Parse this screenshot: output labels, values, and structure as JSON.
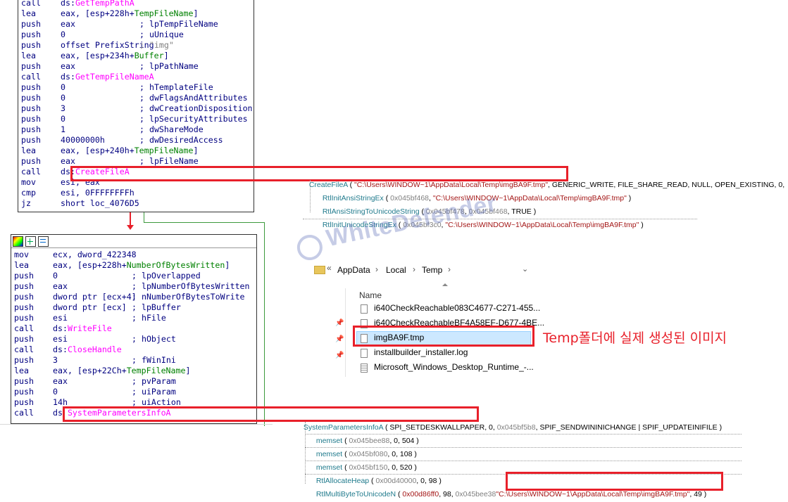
{
  "ida_top": {
    "rows": [
      {
        "mn": "call",
        "op": "ds:",
        "opfn": "GetTempPathA",
        "cm": ""
      },
      {
        "mn": "lea",
        "op": "eax, [esp+228h+",
        "opvar": "TempFileName",
        "op2": "]",
        "cm": ""
      },
      {
        "mn": "push",
        "op": "eax",
        "cm": "; lpTempFileName"
      },
      {
        "mn": "push",
        "op": "0",
        "cm": "; uUnique"
      },
      {
        "mn": "push",
        "op": "offset PrefixString",
        "cm": "; \"img\""
      },
      {
        "mn": "lea",
        "op": "eax, [esp+234h+",
        "opvar": "Buffer",
        "op2": "]",
        "cm": ""
      },
      {
        "mn": "push",
        "op": "eax",
        "cm": "; lpPathName"
      },
      {
        "mn": "call",
        "op": "ds:",
        "opfn": "GetTempFileNameA",
        "cm": ""
      },
      {
        "mn": "push",
        "op": "0",
        "cm": "; hTemplateFile"
      },
      {
        "mn": "push",
        "op": "0",
        "cm": "; dwFlagsAndAttributes"
      },
      {
        "mn": "push",
        "op": "3",
        "cm": "; dwCreationDisposition"
      },
      {
        "mn": "push",
        "op": "0",
        "cm": "; lpSecurityAttributes"
      },
      {
        "mn": "push",
        "op": "1",
        "cm": "; dwShareMode"
      },
      {
        "mn": "push",
        "op": "40000000h",
        "cm": "; dwDesiredAccess"
      },
      {
        "mn": "lea",
        "op": "eax, [esp+240h+",
        "opvar": "TempFileName",
        "op2": "]",
        "cm": ""
      },
      {
        "mn": "push",
        "op": "eax",
        "cm": "; lpFileName"
      },
      {
        "mn": "call",
        "op": "ds:",
        "opfn": "CreateFileA",
        "cm": ""
      },
      {
        "mn": "mov",
        "op": "esi, eax",
        "cm": ""
      },
      {
        "mn": "cmp",
        "op": "esi, 0FFFFFFFFh",
        "cm": ""
      },
      {
        "mn": "jz",
        "op": "short loc_4076D5",
        "cm": ""
      }
    ]
  },
  "ida_bottom": {
    "rows": [
      {
        "mn": "mov",
        "op": "ecx, dword_422348",
        "cm": ""
      },
      {
        "mn": "lea",
        "op": "eax, [esp+228h+",
        "opvar": "NumberOfBytesWritten",
        "op2": "]",
        "cm": ""
      },
      {
        "mn": "push",
        "op": "0",
        "cm": "; lpOverlapped"
      },
      {
        "mn": "push",
        "op": "eax",
        "cm": "; lpNumberOfBytesWritten"
      },
      {
        "mn": "push",
        "op": "dword ptr [ecx+4]",
        "cm": "; nNumberOfBytesToWrite"
      },
      {
        "mn": "push",
        "op": "dword ptr [ecx]",
        "cm": "; lpBuffer"
      },
      {
        "mn": "push",
        "op": "esi",
        "cm": "; hFile"
      },
      {
        "mn": "call",
        "op": "ds:",
        "opfn": "WriteFile",
        "cm": ""
      },
      {
        "mn": "push",
        "op": "esi",
        "cm": "; hObject"
      },
      {
        "mn": "call",
        "op": "ds:",
        "opfn": "CloseHandle",
        "cm": ""
      },
      {
        "mn": "push",
        "op": "3",
        "cm": "; fWinIni"
      },
      {
        "mn": "lea",
        "op": "eax, [esp+22Ch+",
        "opvar": "TempFileName",
        "op2": "]",
        "cm": ""
      },
      {
        "mn": "push",
        "op": "eax",
        "cm": "; pvParam"
      },
      {
        "mn": "push",
        "op": "0",
        "cm": "; uiParam"
      },
      {
        "mn": "push",
        "op": "14h",
        "cm": "; uiAction"
      },
      {
        "mn": "call",
        "op": "ds ",
        "opfn": "SystemParametersInfoA",
        "cm": ""
      }
    ]
  },
  "api_top": {
    "create": {
      "fn": "CreateFileA",
      "p1": " ( ",
      "s1": "\"C:\\Users\\WINDOW~1\\AppData\\Local\\Temp\\imgBA9F.tmp\"",
      "rest": ", GENERIC_WRITE, FILE_SHARE_READ, NULL, OPEN_EXISTING, 0,"
    },
    "c1": {
      "fn": "RtlInitAnsiStringEx",
      "a": " ( ",
      "n": "0x045bf468",
      "b": ", ",
      "s": "\"C:\\Users\\WINDOW~1\\AppData\\Local\\Temp\\imgBA9F.tmp\"",
      "c": " )"
    },
    "c2": {
      "fn": "RtlAnsiStringToUnicodeString",
      "a": " ( ",
      "n": "0x045bf478",
      "b": ", ",
      "n2": "0x045bf468",
      "c": ", TRUE )"
    },
    "c3": {
      "fn": "RtlInitUnicodeStringEx",
      "a": " ( ",
      "n": "0x045bf3c0",
      "b": ", ",
      "s": "\"C:\\Users\\WINDOW~1\\AppData\\Local\\Temp\\imgBA9F.tmp\"",
      "c": " )"
    }
  },
  "api_bottom": {
    "spi": {
      "fn": "SystemParametersInfoA",
      "a": " ( SPI_SETDESKWALLPAPER",
      "b": ", 0, ",
      "n": "0x045bf5b8",
      "c": ", SPIF_SENDWININICHANGE | SPIF_UPDATEINIFILE )"
    },
    "m1": {
      "fn": "memset",
      "a": " ( ",
      "n": "0x045bee88",
      "c": ", 0, 504 )"
    },
    "m2": {
      "fn": "memset",
      "a": " ( ",
      "n": "0x045bf080",
      "c": ", 0, 108 )"
    },
    "m3": {
      "fn": "memset",
      "a": " ( ",
      "n": "0x045bf150",
      "c": ", 0, 520 )"
    },
    "h1": {
      "fn": "RtlAllocateHeap",
      "a": " ( ",
      "n": "0x00d40000",
      "c": ", 0, 98 )"
    },
    "mb": {
      "fn": "RtlMultiByteToUnicodeN",
      "a": " ( ",
      "n": "0x00d86ff0",
      "b": ", 98, ",
      "n2": "0x045bee38",
      "s": "\"C:\\Users\\WINDOW~1\\AppData\\Local\\Temp\\imgBA9F.tmp\"",
      "c": ", 49 )"
    }
  },
  "watermark": "WhiteDefender",
  "explorer": {
    "back": "«",
    "breadcrumb": [
      "AppData",
      "Local",
      "Temp"
    ],
    "column": "Name",
    "files": [
      "i640CheckReachable083C4677-C271-455...",
      "i640CheckReachableBF4A58EF-D677-4BE...",
      "imgBA9F.tmp",
      "installbuilder_installer.log",
      "Microsoft_Windows_Desktop_Runtime_-..."
    ]
  },
  "annotation": "Temp폴더에 실제 생성된 이미지",
  "colors": {
    "red": "#e8202a",
    "fn": "#1f7a8c",
    "str": "#a31515",
    "asm": "#000080",
    "pink": "#ff00ff"
  }
}
